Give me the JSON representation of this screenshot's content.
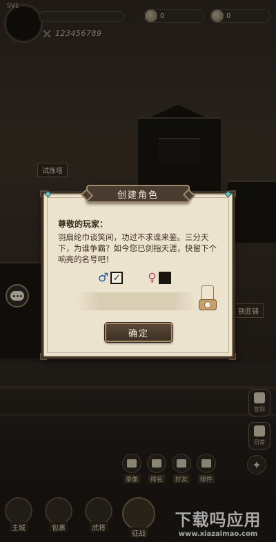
{
  "player": {
    "level": "SV1",
    "uid": "123456789"
  },
  "currencies": [
    {
      "icon": "coin-icon",
      "value": "0"
    },
    {
      "icon": "ingot-icon",
      "value": "0"
    }
  ],
  "scene": {
    "tower_sign": "试炼塔",
    "right_shop_sign": "铁匠铺"
  },
  "dialog": {
    "title": "创建角色",
    "greeting": "尊敬的玩家：",
    "message": "羽扇纶巾谈笑间，功过不求谁来鉴。三分天下，为谁争霸？如今您已剑指天涯，快留下个响亮的名号吧！",
    "male_symbol": "♂",
    "female_symbol": "♀",
    "male_checked": true,
    "female_checked": false,
    "name_value": "",
    "confirm_label": "确定"
  },
  "side_right": [
    {
      "label": "签到"
    },
    {
      "label": "日常"
    }
  ],
  "mid_menu": [
    {
      "label": "录像",
      "icon": "video-icon"
    },
    {
      "label": "排名",
      "icon": "trophy-icon"
    },
    {
      "label": "好友",
      "icon": "friends-icon"
    },
    {
      "label": "邮件",
      "icon": "mail-icon"
    }
  ],
  "bottom_nav": [
    {
      "label": "主城",
      "icon": "city-icon"
    },
    {
      "label": "包裹",
      "icon": "bag-icon"
    },
    {
      "label": "武将",
      "icon": "general-icon"
    },
    {
      "label": "征战",
      "icon": "battle-icon"
    }
  ],
  "watermark": {
    "title": "下载吗应用",
    "url": "www.xiazaimao.com"
  },
  "colors": {
    "dialog_bg": "#ece3cf",
    "dialog_border": "#7c6a52",
    "male": "#1e5aa8",
    "female": "#c14a5e"
  }
}
